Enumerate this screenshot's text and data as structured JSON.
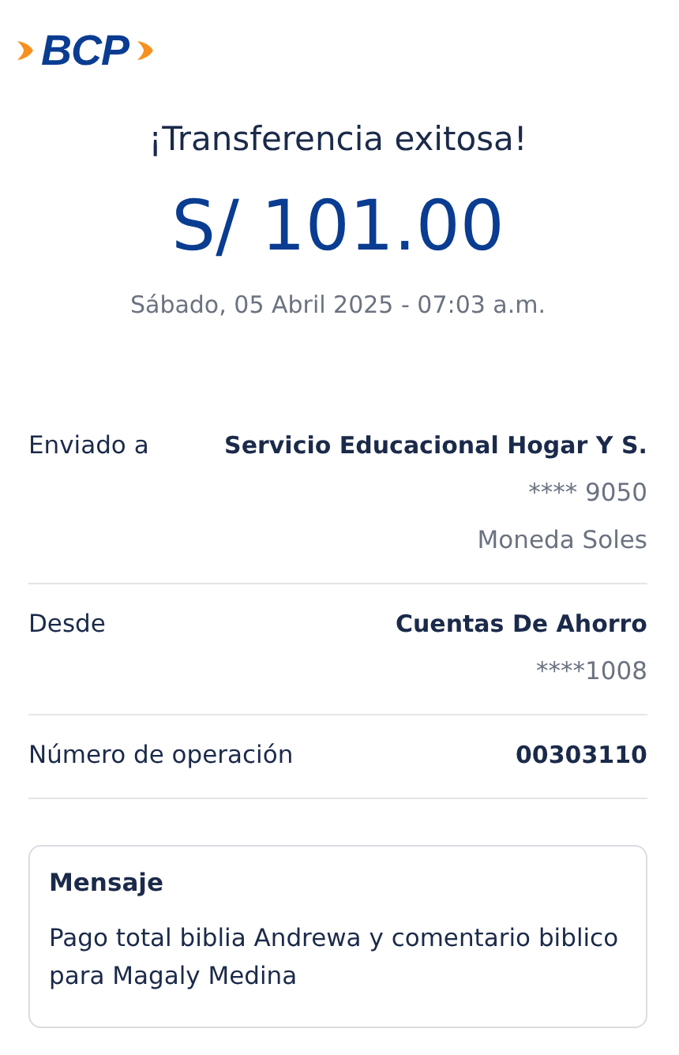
{
  "logo": {
    "text": "BCP"
  },
  "title": "¡Transferencia exitosa!",
  "amount": "S/ 101.00",
  "date": "Sábado, 05 Abril 2025 - 07:03 a.m.",
  "details": [
    {
      "label": "Enviado a",
      "lines": [
        {
          "text": "Servicio Educacional Hogar Y S.",
          "kind": "primary"
        },
        {
          "text": "**** 9050",
          "kind": "secondary"
        },
        {
          "text": "Moneda Soles",
          "kind": "secondary"
        }
      ]
    },
    {
      "label": "Desde",
      "lines": [
        {
          "text": "Cuentas De Ahorro",
          "kind": "primary"
        },
        {
          "text": "****1008",
          "kind": "secondary"
        }
      ]
    },
    {
      "label": "Número de operación",
      "lines": [
        {
          "text": "00303110",
          "kind": "primary"
        }
      ]
    }
  ],
  "message": {
    "title": "Mensaje",
    "text": "Pago total biblia Andrewa y comentario biblico para Magaly Medina"
  }
}
